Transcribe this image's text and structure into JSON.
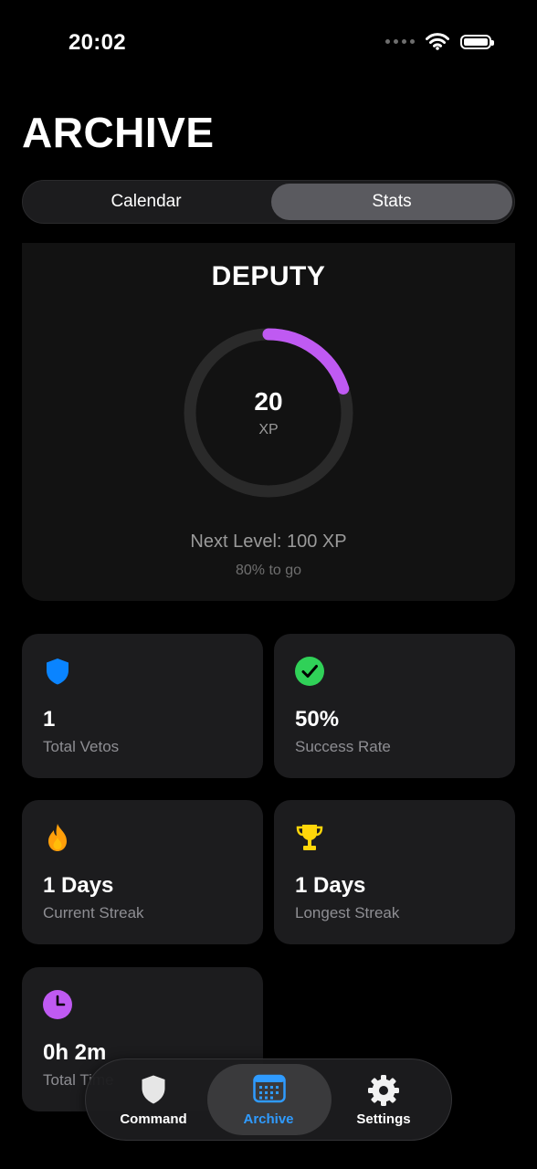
{
  "status_bar": {
    "time": "20:02"
  },
  "page": {
    "title": "ARCHIVE"
  },
  "segments": [
    {
      "label": "Calendar",
      "selected": false
    },
    {
      "label": "Stats",
      "selected": true
    }
  ],
  "level": {
    "name": "DEPUTY",
    "xp": "20",
    "xp_unit": "XP",
    "progress_fraction": 0.2,
    "next_level": "Next Level: 100 XP",
    "to_go": "80% to go",
    "ring_color": "#bf5af2"
  },
  "stats": [
    {
      "icon": "shield-icon",
      "color": "#0a84ff",
      "value": "1",
      "label": "Total Vetos"
    },
    {
      "icon": "checkmark-circle-icon",
      "color": "#30d158",
      "value": "50%",
      "label": "Success Rate"
    },
    {
      "icon": "flame-icon",
      "color": "#ff9f0a",
      "value": "1 Days",
      "label": "Current Streak"
    },
    {
      "icon": "trophy-icon",
      "color": "#ffd60a",
      "value": "1 Days",
      "label": "Longest Streak"
    },
    {
      "icon": "clock-icon",
      "color": "#bf5af2",
      "value": "0h 2m",
      "label": "Total Time"
    }
  ],
  "tabbar": {
    "items": [
      {
        "label": "Command",
        "icon": "shield-icon",
        "active": false
      },
      {
        "label": "Archive",
        "icon": "calendar-icon",
        "active": true
      },
      {
        "label": "Settings",
        "icon": "gear-icon",
        "active": false
      }
    ]
  }
}
